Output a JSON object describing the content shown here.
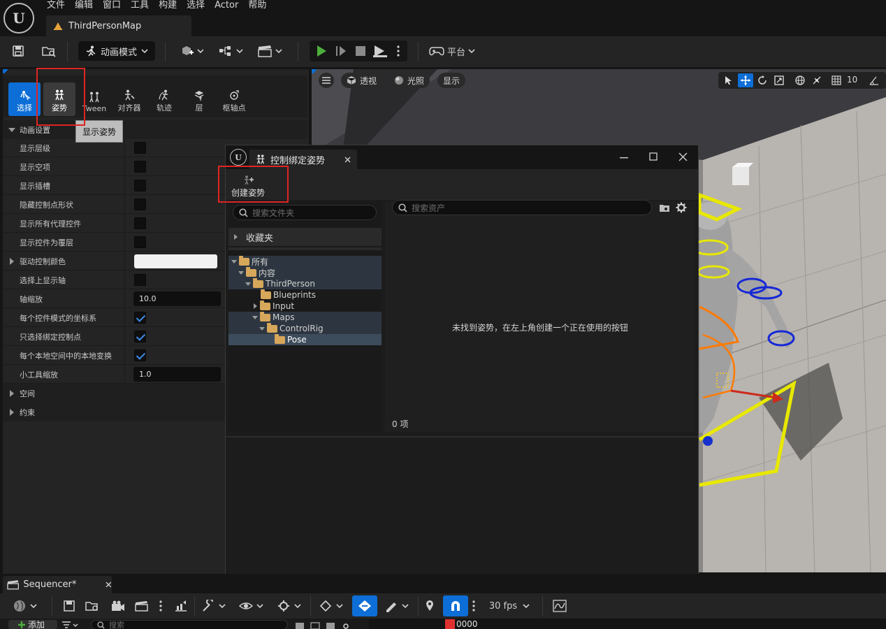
{
  "menu": [
    "文件",
    "编辑",
    "窗口",
    "工具",
    "构建",
    "选择",
    "Actor",
    "帮助"
  ],
  "map_tab": {
    "title": "ThirdPersonMap"
  },
  "toolbar": {
    "mode_label": "动画模式",
    "platform_label": "平台"
  },
  "mode_tools": [
    {
      "label": "选择",
      "icon": "select-icon",
      "state": "active-blue"
    },
    {
      "label": "姿势",
      "icon": "pose-icon",
      "state": "active-gray"
    },
    {
      "label": "Tween",
      "icon": "tween-icon",
      "state": ""
    },
    {
      "label": "对齐器",
      "icon": "snapper-icon",
      "state": ""
    },
    {
      "label": "轨迹",
      "icon": "trail-icon",
      "state": ""
    },
    {
      "label": "层",
      "icon": "layer-icon",
      "state": ""
    },
    {
      "label": "枢轴点",
      "icon": "pivot-icon",
      "state": ""
    }
  ],
  "tooltip": "显示姿势",
  "anim_settings": {
    "header": "动画设置",
    "rows": [
      {
        "label": "显示层级",
        "type": "checkbox",
        "checked": false
      },
      {
        "label": "显示空项",
        "type": "checkbox",
        "checked": false
      },
      {
        "label": "显示插槽",
        "type": "checkbox",
        "checked": false
      },
      {
        "label": "隐藏控制点形状",
        "type": "checkbox",
        "checked": false
      },
      {
        "label": "显示所有代理控件",
        "type": "checkbox",
        "checked": false
      },
      {
        "label": "显示控件为覆层",
        "type": "checkbox",
        "checked": false
      },
      {
        "label": "驱动控制颜色",
        "type": "color",
        "expandable": true,
        "color": "#f2f2f2"
      },
      {
        "label": "选择上显示轴",
        "type": "checkbox",
        "checked": false
      },
      {
        "label": "轴缩放",
        "type": "number",
        "value": "10.0"
      },
      {
        "label": "每个控件模式的坐标系",
        "type": "checkbox",
        "checked": true
      },
      {
        "label": "只选择绑定控制点",
        "type": "checkbox",
        "checked": true
      },
      {
        "label": "每个本地空间中的本地变换",
        "type": "checkbox",
        "checked": true
      },
      {
        "label": "小工具缩放",
        "type": "number",
        "value": "1.0"
      }
    ]
  },
  "sections": [
    "空间",
    "约束"
  ],
  "viewport": {
    "perspective": "透视",
    "lit": "光照",
    "show": "显示",
    "grid_size": "10"
  },
  "pose_dialog": {
    "title": "控制绑定姿势",
    "create_pose": "创建姿势",
    "folder_search_placeholder": "搜索文件夹",
    "asset_search_placeholder": "搜索资产",
    "favorites": "收藏夹",
    "tree": [
      {
        "label": "所有",
        "depth": 0,
        "toggle": "down",
        "hl": true
      },
      {
        "label": "内容",
        "depth": 1,
        "toggle": "down",
        "hl": true
      },
      {
        "label": "ThirdPerson",
        "depth": 2,
        "toggle": "down",
        "hl": true
      },
      {
        "label": "Blueprints",
        "depth": 3,
        "toggle": "none",
        "hl": false
      },
      {
        "label": "Input",
        "depth": 3,
        "toggle": "right",
        "hl": false
      },
      {
        "label": "Maps",
        "depth": 3,
        "toggle": "down",
        "hl": true
      },
      {
        "label": "ControlRig",
        "depth": 4,
        "toggle": "down",
        "hl": true
      },
      {
        "label": "Pose",
        "depth": 5,
        "toggle": "none",
        "sel": true
      }
    ],
    "empty_message": "未找到姿势，在左上角创建一个正在使用的按钮",
    "item_count": "0 项"
  },
  "sequencer": {
    "tab_title": "Sequencer*",
    "fps": "30 fps",
    "add_label": "添加",
    "search_placeholder": "搜索",
    "frame": "0000"
  },
  "colors": {
    "accent_blue": "#0d6ed7",
    "play_green": "#4caf3c",
    "highlight_red": "#e02424",
    "folder": "#d7a75b"
  }
}
